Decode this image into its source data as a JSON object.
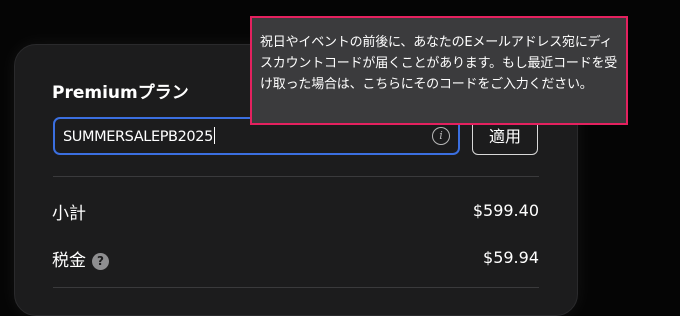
{
  "plan": {
    "title": "Premiumプラン"
  },
  "coupon": {
    "value": "SUMMERSALEPB2025",
    "info_icon_glyph": "i"
  },
  "apply_button": {
    "label": "適用"
  },
  "summary": {
    "subtotal_label": "小計",
    "subtotal_value": "$599.40",
    "tax_label": "税金",
    "tax_help_glyph": "?",
    "tax_value": "$59.94"
  },
  "tooltip": {
    "text": "祝日やイベントの前後に、あなたのEメールアドレス宛にディスカウントコードが届くことがあります。もし最近コードを受け取った場合は、こちらにそのコードをご入力ください。"
  },
  "colors": {
    "accent_focus": "#3b6fe0",
    "highlight_border": "#e4215f"
  }
}
